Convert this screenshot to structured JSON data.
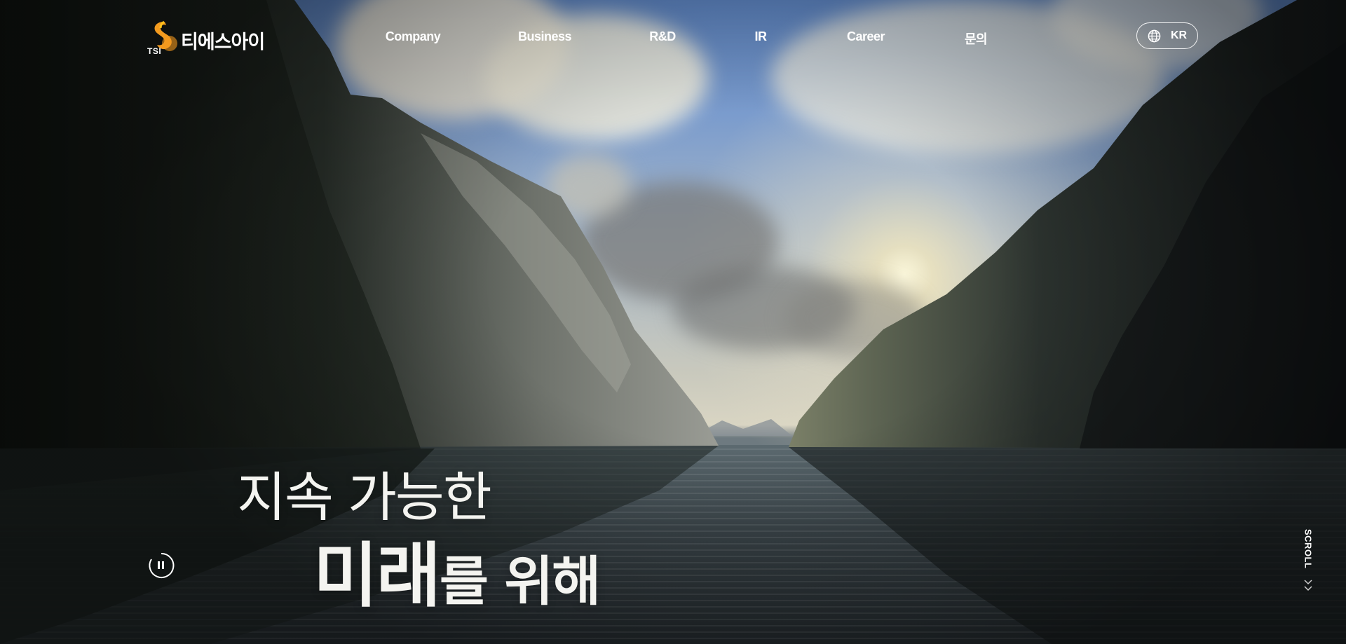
{
  "brand": {
    "mark_text": "TSI",
    "name": "티에스아이",
    "colors": {
      "mark_orange": "#F39A1E",
      "mark_yellow": "#FFC21A"
    }
  },
  "nav": {
    "items": [
      {
        "label": "Company"
      },
      {
        "label": "Business"
      },
      {
        "label": "R&D"
      },
      {
        "label": "IR"
      },
      {
        "label": "Career"
      },
      {
        "label": "문의"
      }
    ]
  },
  "language": {
    "icon": "globe-icon",
    "label": "KR"
  },
  "hero": {
    "headline_line1": "지속 가능한",
    "headline_line2_strong": "미래",
    "headline_line2_rest": "를 위해"
  },
  "controls": {
    "pause_icon": "pause-icon",
    "scroll_label": "SCROLL",
    "scroll_icon": "double-chevron-down-icon"
  }
}
